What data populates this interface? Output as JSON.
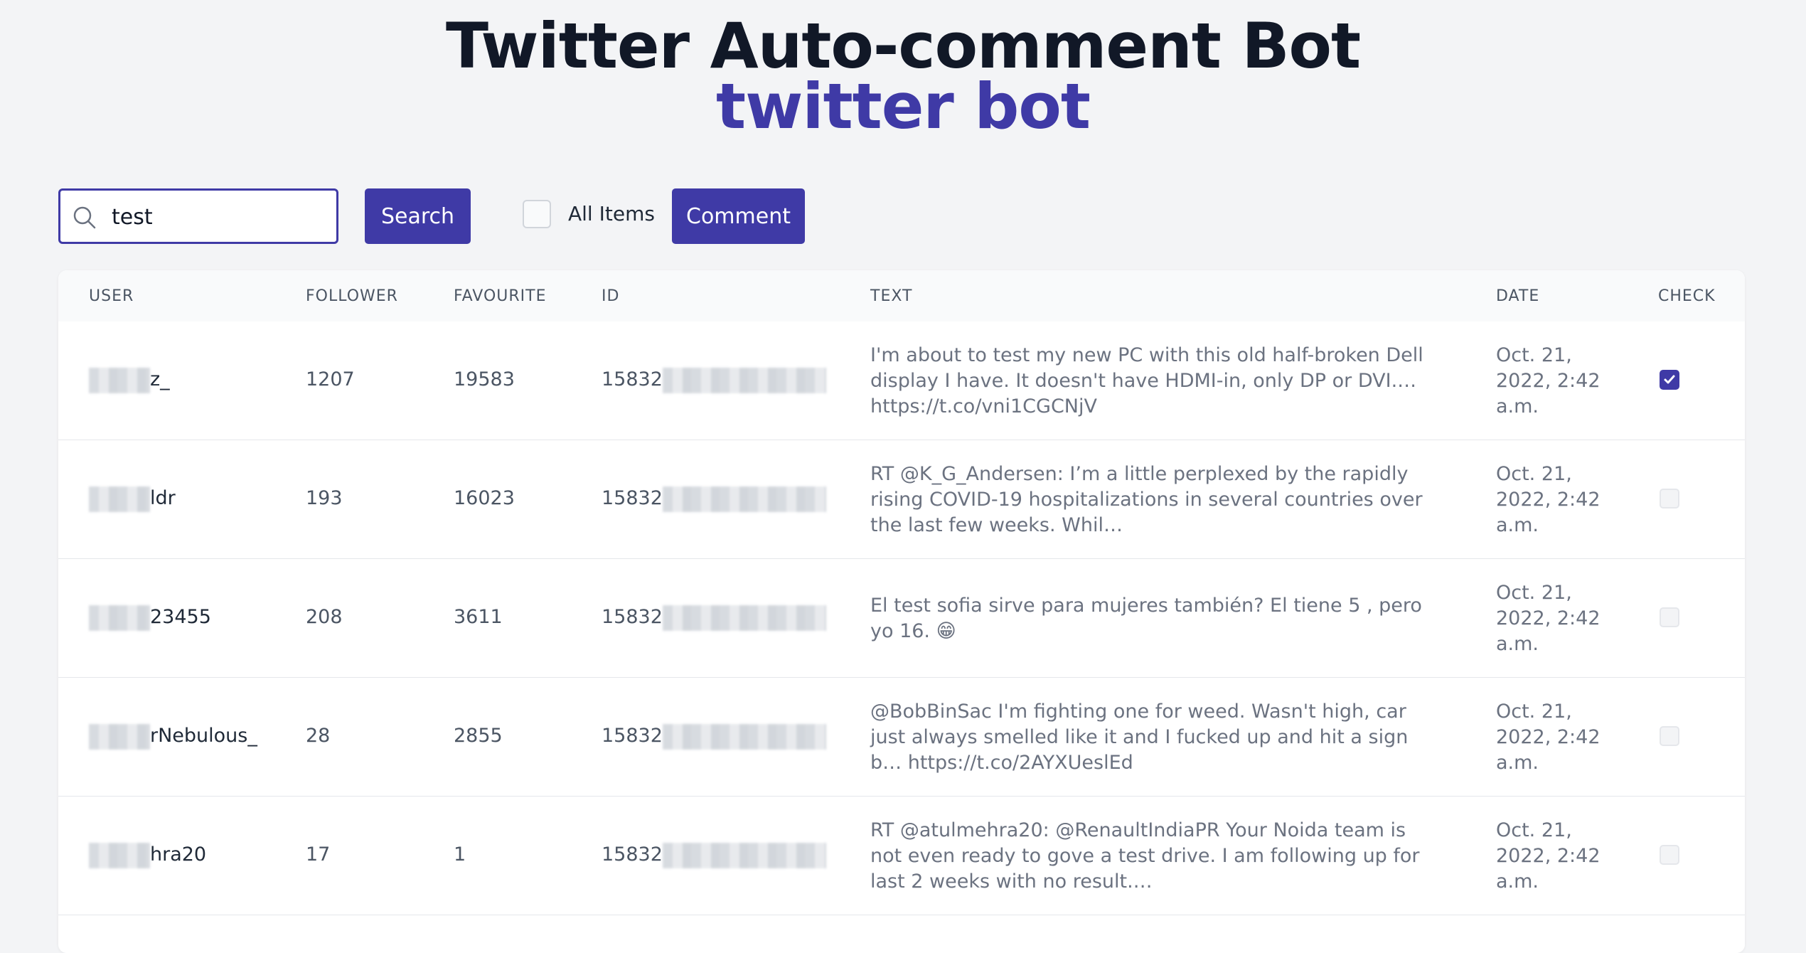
{
  "header": {
    "title": "Twitter Auto-comment Bot",
    "subtitle": "twitter bot"
  },
  "toolbar": {
    "search_value": "test",
    "search_button": "Search",
    "all_items_label": "All Items",
    "all_items_checked": false,
    "comment_button": "Comment"
  },
  "table": {
    "columns": [
      "USER",
      "FOLLOWER",
      "FAVOURITE",
      "ID",
      "TEXT",
      "DATE",
      "CHECK"
    ],
    "rows": [
      {
        "user": "z_",
        "follower": "1207",
        "favourite": "19583",
        "id": "15832",
        "text": "I'm about to test my new PC with this old half-broken Dell display I have. It doesn't have HDMI-in, only DP or DVI.… https://t.co/vni1CGCNjV",
        "date": "Oct. 21, 2022, 2:42 a.m.",
        "checked": true
      },
      {
        "user": "ldr",
        "follower": "193",
        "favourite": "16023",
        "id": "15832",
        "text": "RT @K_G_Andersen: I’m a little perplexed by the rapidly rising COVID-19 hospitalizations in several countries over the last few weeks. Whil…",
        "date": "Oct. 21, 2022, 2:42 a.m.",
        "checked": false
      },
      {
        "user": "23455",
        "follower": "208",
        "favourite": "3611",
        "id": "15832",
        "text": "El test sofia sirve para mujeres también? El tiene 5 , pero yo 16. 😁",
        "date": "Oct. 21, 2022, 2:42 a.m.",
        "checked": false
      },
      {
        "user": "rNebulous_",
        "follower": "28",
        "favourite": "2855",
        "id": "15832",
        "text": "@BobBinSac I'm fighting one for weed. Wasn't high, car just always smelled like it and I fucked up and hit a sign b… https://t.co/2AYXUeslEd",
        "date": "Oct. 21, 2022, 2:42 a.m.",
        "checked": false
      },
      {
        "user": "hra20",
        "follower": "17",
        "favourite": "1",
        "id": "15832",
        "text": "RT @atulmehra20: @RenaultIndiaPR Your Noida team is not even ready to gove a test drive. I am following up for last 2 weeks with no result.…",
        "date": "Oct. 21, 2022, 2:42 a.m.",
        "checked": false
      }
    ]
  }
}
